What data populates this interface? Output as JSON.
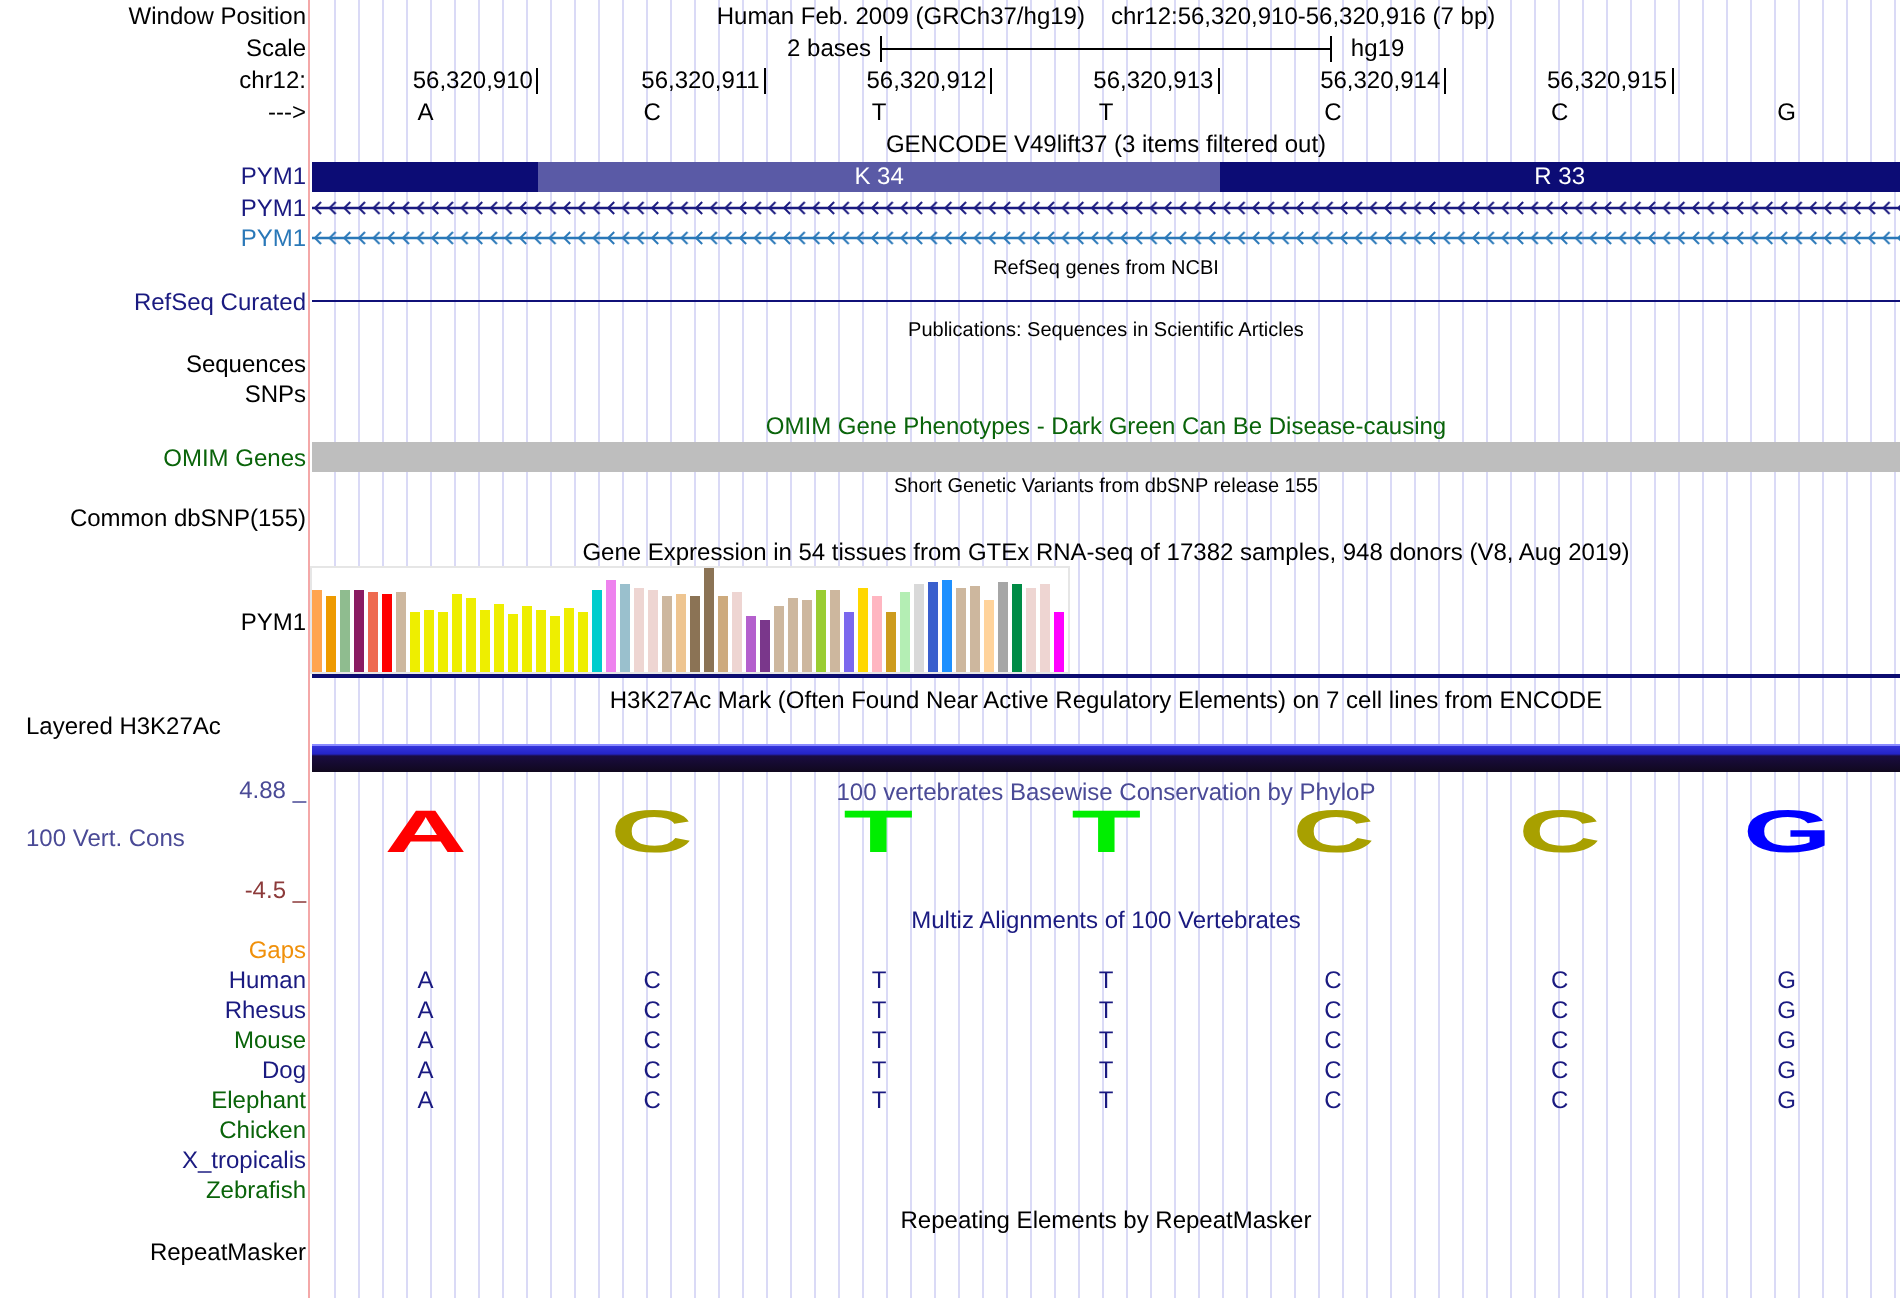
{
  "header": {
    "position_label": "Window Position",
    "assembly": "Human Feb. 2009 (GRCh37/hg19)",
    "range": "chr12:56,320,910-56,320,916 (7 bp)",
    "scale_label": "Scale",
    "scale_text": "2 bases",
    "scale_db": "hg19",
    "chrom_label": "chr12:",
    "positions": [
      "56,320,910",
      "56,320,911",
      "56,320,912",
      "56,320,913",
      "56,320,914",
      "56,320,915"
    ],
    "strand_label": "--->",
    "bases": [
      "A",
      "C",
      "T",
      "T",
      "C",
      "C",
      "G"
    ]
  },
  "gencode": {
    "title": "GENCODE V49lift37 (3 items filtered out)",
    "transcripts": [
      {
        "label": "PYM1",
        "color": "#1a1a80",
        "kind": "codons",
        "segments": [
          {
            "color": "#0c0c75"
          },
          {
            "label": "K 34",
            "color": "#5a5aa6"
          },
          {
            "label": "R 33",
            "color": "#0c0c75"
          }
        ]
      },
      {
        "label": "PYM1",
        "color": "#1a1a80",
        "kind": "line"
      },
      {
        "label": "PYM1",
        "color": "#2a78b8",
        "kind": "line"
      }
    ]
  },
  "refseq": {
    "title": "RefSeq genes from NCBI",
    "label": "RefSeq Curated"
  },
  "publications": {
    "title": "Publications: Sequences in Scientific Articles",
    "labels": [
      "Sequences",
      "SNPs"
    ]
  },
  "omim": {
    "title": "OMIM Gene Phenotypes - Dark Green Can Be Disease-causing",
    "label": "OMIM Genes"
  },
  "dbsnp": {
    "title": "Short Genetic Variants from dbSNP release 155",
    "label": "Common dbSNP(155)"
  },
  "gtex": {
    "title": "Gene Expression in 54 tissues from GTEx RNA-seq of 17382 samples, 948 donors (V8, Aug 2019)",
    "label": "PYM1"
  },
  "h3k27ac": {
    "title": "H3K27Ac Mark (Often Found Near Active Regulatory Elements) on 7 cell lines from ENCODE",
    "label": "Layered H3K27Ac"
  },
  "conservation": {
    "title": "100 vertebrates Basewise Conservation by PhyloP",
    "label": "100 Vert. Cons",
    "axis_max": "4.88 _",
    "axis_min": "-4.5 _",
    "logo": [
      {
        "letter": "A",
        "color": "#ff0000"
      },
      {
        "letter": "C",
        "color": "#a8a000"
      },
      {
        "letter": "T",
        "color": "#00ee00"
      },
      {
        "letter": "T",
        "color": "#00ee00"
      },
      {
        "letter": "C",
        "color": "#a8a000"
      },
      {
        "letter": "C",
        "color": "#a8a000"
      },
      {
        "letter": "G",
        "color": "#0000ff"
      }
    ]
  },
  "multiz": {
    "title": "Multiz Alignments of 100 Vertebrates",
    "rows": [
      {
        "name": "Gaps",
        "color": "#f0900a"
      },
      {
        "name": "Human",
        "color": "#1a1a80",
        "bases": [
          "A",
          "C",
          "T",
          "T",
          "C",
          "C",
          "G"
        ]
      },
      {
        "name": "Rhesus",
        "color": "#1a1a80",
        "bases": [
          "A",
          "C",
          "T",
          "T",
          "C",
          "C",
          "G"
        ]
      },
      {
        "name": "Mouse",
        "color": "#0a640a",
        "bases": [
          "A",
          "C",
          "T",
          "T",
          "C",
          "C",
          "G"
        ]
      },
      {
        "name": "Dog",
        "color": "#1a1a80",
        "bases": [
          "A",
          "C",
          "T",
          "T",
          "C",
          "C",
          "G"
        ]
      },
      {
        "name": "Elephant",
        "color": "#0a640a",
        "bases": [
          "A",
          "C",
          "T",
          "T",
          "C",
          "C",
          "G"
        ]
      },
      {
        "name": "Chicken",
        "color": "#0a640a"
      },
      {
        "name": "X_tropicalis",
        "color": "#1a1a80"
      },
      {
        "name": "Zebrafish",
        "color": "#0a640a"
      }
    ]
  },
  "repeatmasker": {
    "title": "Repeating Elements by RepeatMasker",
    "label": "RepeatMasker"
  }
}
